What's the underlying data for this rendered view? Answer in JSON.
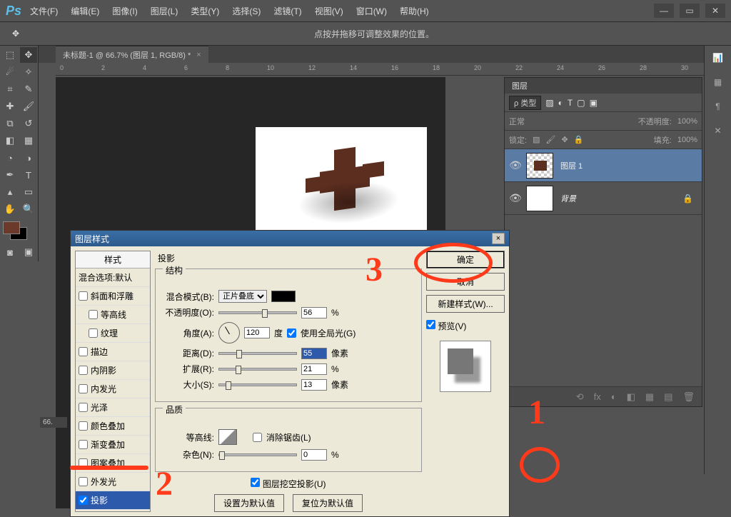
{
  "app": {
    "logo": "Ps"
  },
  "menu": [
    "文件(F)",
    "编辑(E)",
    "图像(I)",
    "图层(L)",
    "类型(Y)",
    "选择(S)",
    "滤镜(T)",
    "视图(V)",
    "窗口(W)",
    "帮助(H)"
  ],
  "win_controls": {
    "min": "—",
    "max": "▭",
    "close": "✕"
  },
  "optionsbar": {
    "hint": "点按并拖移可调整效果的位置。"
  },
  "doc_tab": {
    "title": "未标题-1 @ 66.7% (图层 1, RGB/8) *",
    "close": "×"
  },
  "ruler_ticks": [
    "0",
    "2",
    "4",
    "6",
    "8",
    "10",
    "12",
    "14",
    "16",
    "18",
    "20",
    "22",
    "24",
    "26",
    "28",
    "30"
  ],
  "zoom_display": "66.",
  "layers_panel": {
    "title": "图层",
    "kind_label": "ρ 类型",
    "blend_mode": "正常",
    "opacity_label": "不透明度:",
    "opacity_value": "100%",
    "lock_label": "锁定:",
    "fill_label": "填充:",
    "fill_value": "100%",
    "layers": [
      {
        "name": "图层 1",
        "selected": true
      },
      {
        "name": "背景",
        "locked": true,
        "italic": true
      }
    ],
    "bottom_icons": [
      "⟲",
      "fx",
      "◐",
      "◧",
      "▦",
      "▤",
      "🗑"
    ]
  },
  "dialog": {
    "title": "图层样式",
    "styles_header": "样式",
    "blend_options": "混合选项:默认",
    "style_list": [
      {
        "label": "斜面和浮雕",
        "checked": false,
        "indent": 0
      },
      {
        "label": "等高线",
        "checked": false,
        "indent": 1
      },
      {
        "label": "纹理",
        "checked": false,
        "indent": 1
      },
      {
        "label": "描边",
        "checked": false,
        "indent": 0
      },
      {
        "label": "内阴影",
        "checked": false,
        "indent": 0
      },
      {
        "label": "内发光",
        "checked": false,
        "indent": 0
      },
      {
        "label": "光泽",
        "checked": false,
        "indent": 0
      },
      {
        "label": "颜色叠加",
        "checked": false,
        "indent": 0
      },
      {
        "label": "渐变叠加",
        "checked": false,
        "indent": 0
      },
      {
        "label": "图案叠加",
        "checked": false,
        "indent": 0
      },
      {
        "label": "外发光",
        "checked": false,
        "indent": 0
      },
      {
        "label": "投影",
        "checked": true,
        "indent": 0,
        "selected": true
      }
    ],
    "section_title": "投影",
    "structure_title": "结构",
    "blend_mode_label": "混合模式(B):",
    "blend_mode_value": "正片叠底",
    "opacity_label": "不透明度(O):",
    "opacity_value": "56",
    "opacity_unit": "%",
    "angle_label": "角度(A):",
    "angle_value": "120",
    "angle_unit": "度",
    "global_light": "使用全局光(G)",
    "distance_label": "距离(D):",
    "distance_value": "55",
    "distance_unit": "像素",
    "spread_label": "扩展(R):",
    "spread_value": "21",
    "spread_unit": "%",
    "size_label": "大小(S):",
    "size_value": "13",
    "size_unit": "像素",
    "quality_title": "品质",
    "contour_label": "等高线:",
    "antialias": "消除锯齿(L)",
    "noise_label": "杂色(N):",
    "noise_value": "0",
    "noise_unit": "%",
    "knockout": "图层挖空投影(U)",
    "set_default": "设置为默认值",
    "reset_default": "复位为默认值",
    "ok": "确定",
    "cancel": "取消",
    "new_style": "新建样式(W)...",
    "preview": "预览(V)"
  },
  "annotations": {
    "n1": "1",
    "n2": "2",
    "n3": "3"
  }
}
